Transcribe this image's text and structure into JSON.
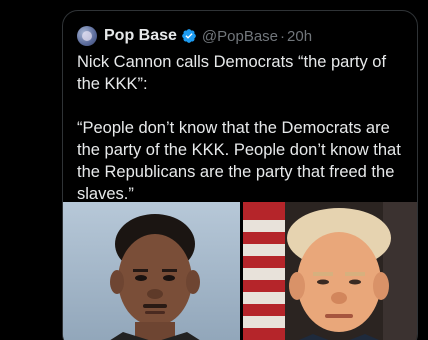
{
  "post": {
    "author_name": "Pop Base",
    "handle": "@PopBase",
    "separator": "·",
    "time": "20h",
    "headline": "Nick Cannon calls Democrats “the party of the KKK”:",
    "quote": "“People don’t know that the Democrats are the party of the KKK. People don’t know that the Republicans are the party that freed the slaves.”"
  },
  "icons": {
    "avatar": "avatar-icon",
    "verified": "verified-badge-icon"
  },
  "colors": {
    "background": "#000000",
    "primary_text": "#e7e9ea",
    "secondary_text": "#71767b",
    "verified_badge": "#1d9bf0",
    "border": "#2f3336"
  }
}
